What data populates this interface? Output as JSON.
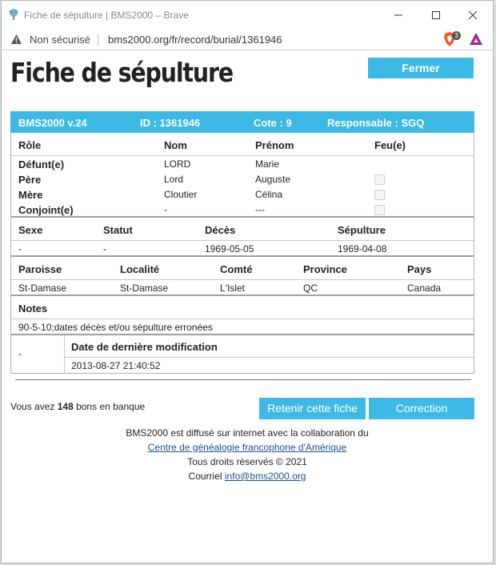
{
  "window": {
    "title": "Fiche de sépulture | BMS2000 – Brave"
  },
  "addressbar": {
    "security_label": "Non sécurisé",
    "url": "bms2000.org/fr/record/burial/1361946",
    "brave_badge": "3"
  },
  "page": {
    "title": "Fiche de sépulture",
    "close_button": "Fermer"
  },
  "record": {
    "header": {
      "version": "BMS2000 v.24",
      "id": "ID : 1361946",
      "cote": "Cote : 9",
      "responsable": "Responsable : SGQ"
    },
    "persons": {
      "columns": [
        "Rôle",
        "Nom",
        "Prénom",
        "Feu(e)"
      ],
      "rows": [
        {
          "role": "Défunt(e)",
          "nom": "LORD",
          "prenom": "Marie",
          "feu": false,
          "show_check": false
        },
        {
          "role": "Père",
          "nom": "Lord",
          "prenom": "Auguste",
          "feu": false,
          "show_check": true
        },
        {
          "role": "Mère",
          "nom": "Cloutier",
          "prenom": "Célina",
          "feu": false,
          "show_check": true
        },
        {
          "role": "Conjoint(e)",
          "nom": "-",
          "prenom": "---",
          "feu": false,
          "show_check": true
        }
      ]
    },
    "vitals": {
      "columns": [
        "Sexe",
        "Statut",
        "Décès",
        "Sépulture"
      ],
      "values": [
        "-",
        "-",
        "1969-05-05",
        "1969-04-08"
      ]
    },
    "location": {
      "columns": [
        "Paroisse",
        "Localité",
        "Comté",
        "Province",
        "Pays"
      ],
      "values": [
        "St-Damase",
        "St-Damase",
        "L'Islet",
        "QC",
        "Canada"
      ]
    },
    "notes": {
      "label": "Notes",
      "text": "90-5-10;dates décès et/ou sépulture erronées"
    },
    "modification": {
      "left_value": "-",
      "label": "Date de dernière modification",
      "value": "2013-08-27 21:40:52"
    }
  },
  "actions": {
    "credits_prefix": "Vous avez ",
    "credits_count": "148",
    "credits_suffix": " bons en banque",
    "keep_button": "Retenir cette fiche",
    "correction_button": "Correction"
  },
  "footer": {
    "line1": "BMS2000 est diffusé sur internet avec la collaboration du",
    "link1": "Centre de généalogie francophone d'Amérique",
    "line3": "Tous droits réservés © 2021",
    "line4_prefix": "Courriel ",
    "email": "info@bms2000.org"
  },
  "colors": {
    "accent": "#3cb9e4",
    "link": "#1f4e8c"
  }
}
